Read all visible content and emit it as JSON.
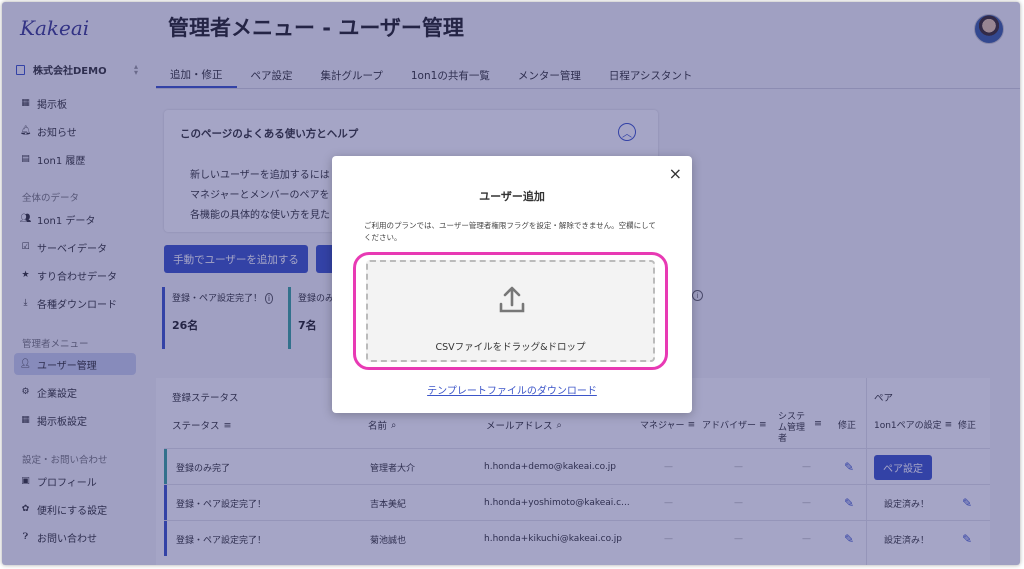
{
  "app": {
    "logo": "Kakeai"
  },
  "sidebar": {
    "company": "株式会社DEMO",
    "items_top": [
      {
        "label": "掲示板",
        "icon": "board-icon"
      },
      {
        "label": "お知らせ",
        "icon": "bell-icon"
      },
      {
        "label": "1on1 履歴",
        "icon": "history-icon"
      }
    ],
    "section_data": "全体のデータ",
    "items_data": [
      {
        "label": "1on1 データ",
        "icon": "people-icon"
      },
      {
        "label": "サーベイデータ",
        "icon": "survey-icon"
      },
      {
        "label": "すり合わせデータ",
        "icon": "pin-icon"
      },
      {
        "label": "各種ダウンロード",
        "icon": "download-icon"
      }
    ],
    "section_admin": "管理者メニュー",
    "items_admin": [
      {
        "label": "ユーザー管理",
        "icon": "user-manage-icon"
      },
      {
        "label": "企業設定",
        "icon": "company-settings-icon"
      },
      {
        "label": "掲示板設定",
        "icon": "board-settings-icon"
      }
    ],
    "section_settings": "設定・お問い合わせ",
    "items_settings": [
      {
        "label": "プロフィール",
        "icon": "profile-icon"
      },
      {
        "label": "便利にする設定",
        "icon": "gear-icon"
      },
      {
        "label": "お問い合わせ",
        "icon": "help-icon"
      }
    ]
  },
  "header": {
    "title": "管理者メニュー - ユーザー管理"
  },
  "tabs": [
    {
      "label": "追加・修正"
    },
    {
      "label": "ペア設定"
    },
    {
      "label": "集計グループ"
    },
    {
      "label": "1on1の共有一覧"
    },
    {
      "label": "メンター管理"
    },
    {
      "label": "日程アシスタント"
    }
  ],
  "help": {
    "title": "このページのよくある使い方とヘルプ",
    "lines": [
      "新しいユーザーを追加するには",
      "マネジャーとメンバーのペアを",
      "各機能の具体的な使い方を見た"
    ]
  },
  "actions": {
    "add_manual": "手動でユーザーを追加する"
  },
  "stats": [
    {
      "label": "登録・ペア設定完了！",
      "value": "26名"
    },
    {
      "label": "登録のみ",
      "value": "7名"
    }
  ],
  "table": {
    "group_status": "登録ステータス",
    "group_pair": "ペア",
    "headers": {
      "status": "ステータス",
      "name": "名前",
      "email": "メールアドレス",
      "manager": "マネジャー",
      "advisor": "アドバイザー",
      "sysadmin": "システム管理者",
      "edit": "修正",
      "pair_setting": "1on1ペアの設定",
      "pair_edit": "修正"
    },
    "rows": [
      {
        "status": "登録のみ完了",
        "name": "管理者大介",
        "email": "h.honda+demo@kakeai.co.jp",
        "manager": "—",
        "advisor": "—",
        "sysadmin": "—",
        "pair": "ペア設定",
        "pair_button": true
      },
      {
        "status": "登録・ペア設定完了！",
        "name": "吉本美紀",
        "email": "h.honda+yoshimoto@kakeai.c...",
        "manager": "—",
        "advisor": "—",
        "sysadmin": "—",
        "pair": "設定済み！",
        "pair_button": false
      },
      {
        "status": "登録・ペア設定完了！",
        "name": "菊池誠也",
        "email": "h.honda+kikuchi@kakeai.co.jp",
        "manager": "—",
        "advisor": "—",
        "sysadmin": "—",
        "pair": "設定済み！",
        "pair_button": false
      }
    ]
  },
  "modal": {
    "title": "ユーザー追加",
    "note": "ご利用のプランでは、ユーザー管理者権限フラグを設定・解除できません。空欄にしてください。",
    "drop_text": "CSVファイルをドラッグ&ドロップ",
    "template_link": "テンプレートファイルのダウンロード",
    "close": "×"
  },
  "colors": {
    "accent": "#3c55c8",
    "highlight": "#e83ab4",
    "green": "#3aa59b"
  }
}
